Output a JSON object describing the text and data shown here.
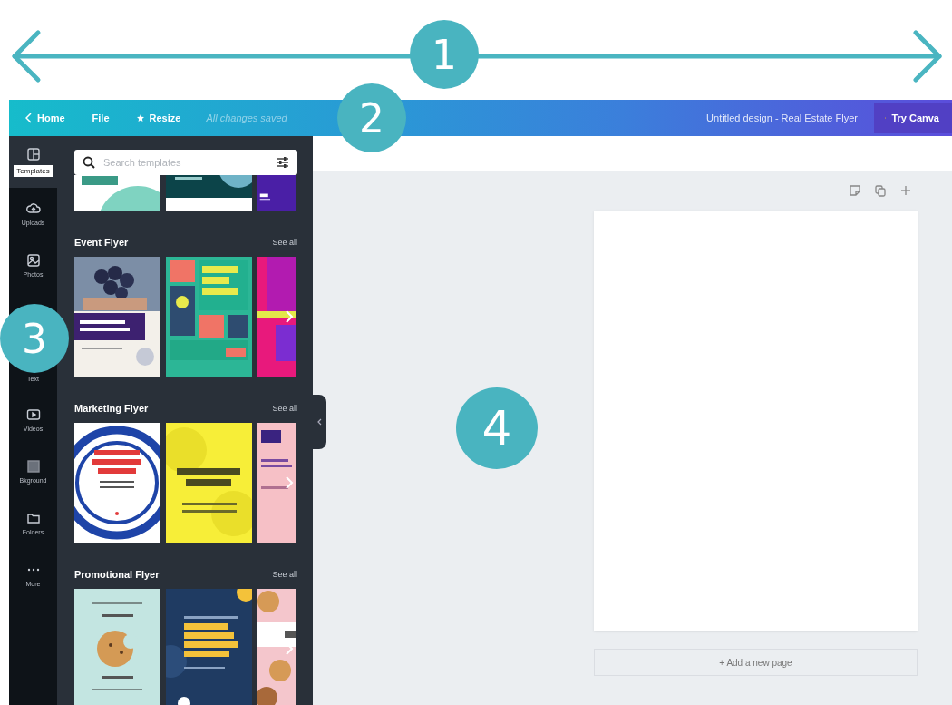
{
  "annotations": [
    {
      "label": "1"
    },
    {
      "label": "2"
    },
    {
      "label": "3"
    },
    {
      "label": "4"
    }
  ],
  "top_bar": {
    "back_label": "Home",
    "menu": [
      "File"
    ],
    "resize_label": "Resize",
    "save_status": "All changes saved",
    "design_title": "Untitled design - Real Estate Flyer",
    "upgrade_button": "Try Canva"
  },
  "sidebar": {
    "items": [
      {
        "label": "Templates",
        "selected": true,
        "kind": "templates"
      },
      {
        "label": "Uploads",
        "selected": false,
        "kind": "uploads"
      },
      {
        "label": "Photos",
        "selected": false,
        "kind": "photos"
      },
      {
        "label": "Text",
        "selected": false,
        "kind": "text"
      },
      {
        "label": "Videos",
        "selected": false,
        "kind": "videos"
      },
      {
        "label": "Bkground",
        "selected": false,
        "kind": "background"
      },
      {
        "label": "Folders",
        "selected": false,
        "kind": "folders"
      },
      {
        "label": "More",
        "selected": false,
        "kind": "more"
      }
    ]
  },
  "template_panel": {
    "search": {
      "placeholder": "Search templates"
    },
    "sections": [
      {
        "title": "Event Flyer",
        "see_all": "See all"
      },
      {
        "title": "Marketing Flyer",
        "see_all": "See all"
      },
      {
        "title": "Promotional Flyer",
        "see_all": "See all"
      }
    ]
  },
  "canvas": {
    "add_page_button": "+ Add a new page"
  }
}
